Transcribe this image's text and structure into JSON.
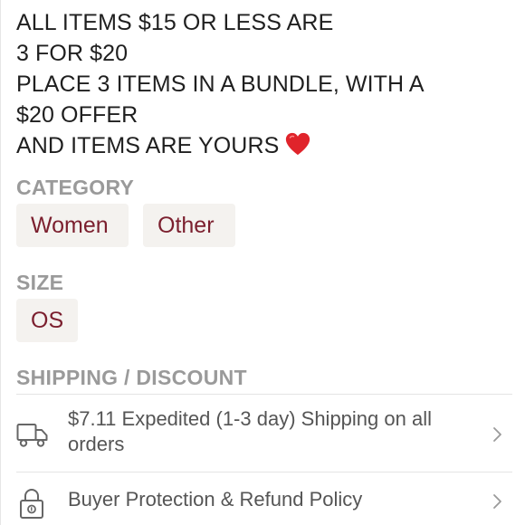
{
  "description": {
    "lines": [
      "ALL ITEMS $15 OR LESS ARE",
      "3 FOR $20",
      "PLACE 3 ITEMS IN A BUNDLE, WITH A",
      "$20 OFFER",
      "AND ITEMS ARE YOURS"
    ],
    "heart_icon": "red-heart-emoji"
  },
  "category": {
    "title": "CATEGORY",
    "chips": [
      "Women",
      "Other"
    ]
  },
  "size": {
    "title": "SIZE",
    "chips": [
      "OS"
    ]
  },
  "shipping": {
    "title": "SHIPPING / DISCOUNT",
    "rows": [
      {
        "icon": "truck-icon",
        "text": "$7.11 Expedited (1-3 day) Shipping on all orders"
      },
      {
        "icon": "lock-icon",
        "text": "Buyer Protection & Refund Policy"
      }
    ]
  },
  "colors": {
    "chip_text": "#7b1f2e",
    "chip_bg": "#f4f2ef",
    "section_title": "#9a9a9a",
    "heart": "#e0242b"
  }
}
